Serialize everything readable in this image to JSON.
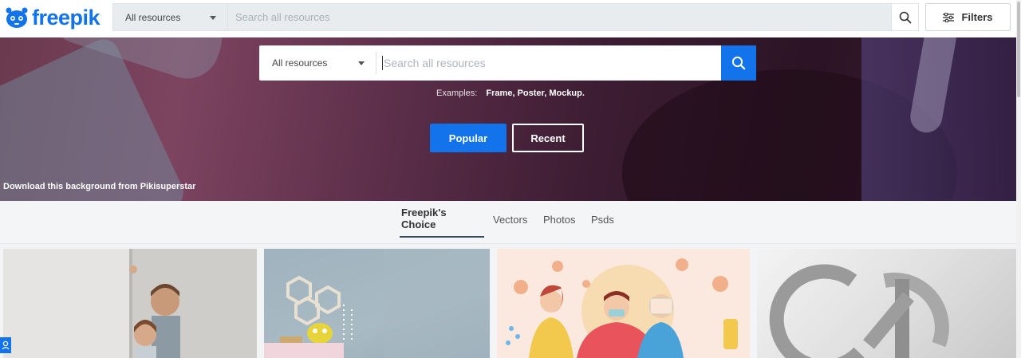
{
  "brand": {
    "name": "freepik",
    "color": "#1273eb"
  },
  "topbar": {
    "resource_select": "All resources",
    "search_placeholder": "Search all resources",
    "filters_label": "Filters"
  },
  "hero": {
    "resource_select": "All resources",
    "search_placeholder": "Search all resources",
    "examples_label": "Examples:",
    "examples": [
      "Frame,",
      "Poster,",
      "Mockup."
    ],
    "popular_label": "Popular",
    "recent_label": "Recent",
    "credit_text": "Download this background from Pikisuperstar"
  },
  "tabs": [
    {
      "label": "Freepik's Choice",
      "active": true
    },
    {
      "label": "Vectors",
      "active": false
    },
    {
      "label": "Photos",
      "active": false
    },
    {
      "label": "Psds",
      "active": false
    }
  ],
  "gallery": {
    "items": [
      {
        "alt": "Children peeking behind white board mockup"
      },
      {
        "alt": "Kids room interior with shelves and toy"
      },
      {
        "alt": "Illustration of people wearing masks"
      },
      {
        "alt": "Embossed logo mockup on paper"
      }
    ]
  },
  "icons": {
    "search": "search-icon",
    "filters": "sliders-icon",
    "user": "user-icon",
    "logo": "freepik-logo-icon"
  },
  "colors": {
    "accent": "#1273eb",
    "tab_underline": "#374a5e"
  }
}
